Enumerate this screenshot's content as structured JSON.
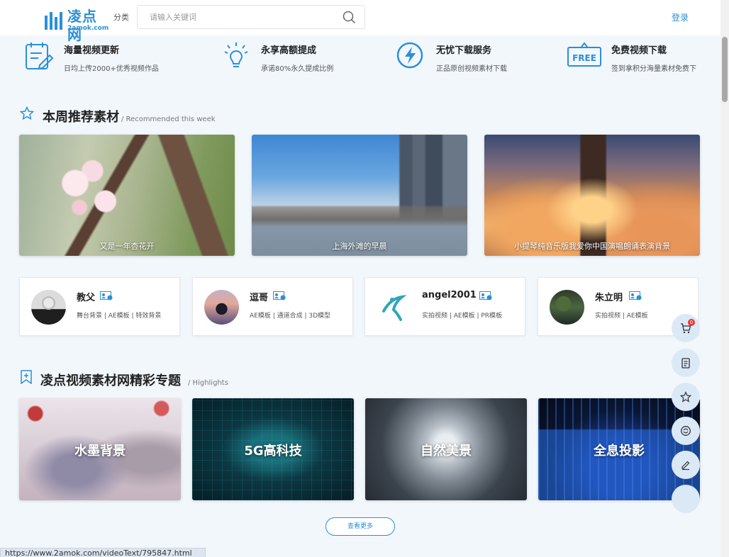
{
  "header": {
    "logo_brand": "凌点网",
    "logo_domain": "2amok.com",
    "category_label": "分类",
    "search_placeholder": "请输入关键词",
    "login_label": "登录"
  },
  "features": [
    {
      "title": "海量视频更新",
      "desc": "日均上传2000+优秀视频作品",
      "icon": "document-edit-icon"
    },
    {
      "title": "永享高额提成",
      "desc": "承诺80%永久提成比例",
      "icon": "lightbulb-icon"
    },
    {
      "title": "无忧下载服务",
      "desc": "正品原创视频素材下载",
      "icon": "lightning-icon"
    },
    {
      "title": "免费视频下载",
      "desc": "签到拿积分海量素材免费下",
      "icon": "free-tag-icon"
    }
  ],
  "free_tag_text": "FREE",
  "recommended": {
    "title": "本周推荐素材",
    "subtitle": "/ Recommended this week",
    "items": [
      {
        "caption": "又是一年杏花开"
      },
      {
        "caption": "上海外滩的早晨"
      },
      {
        "caption": "小提琴纯音乐版我爱你中国演唱朗诵表演背景"
      }
    ]
  },
  "authors": [
    {
      "name": "教父",
      "tags": "舞台背景 | AE模板 | 特效背景"
    },
    {
      "name": "逗哥",
      "tags": "AE模板 | 通道合成 | 3D模型"
    },
    {
      "name": "angel2001",
      "tags": "实拍视频 | AE模板 | PR模板"
    },
    {
      "name": "朱立明",
      "tags": "实拍视频 | AE模板"
    }
  ],
  "highlights": {
    "title": "凌点视频素材网精彩专题",
    "subtitle": "/ Highlights",
    "items": [
      {
        "label": "水墨背景"
      },
      {
        "label": "5G高科技"
      },
      {
        "label": "自然美景"
      },
      {
        "label": "全息投影"
      }
    ]
  },
  "more_button": "查看更多",
  "cart_count": "0",
  "status_url": "https://www.2amok.com/videoText/795847.html",
  "colors": {
    "accent": "#2a8fd8",
    "background": "#f2f7fc"
  }
}
